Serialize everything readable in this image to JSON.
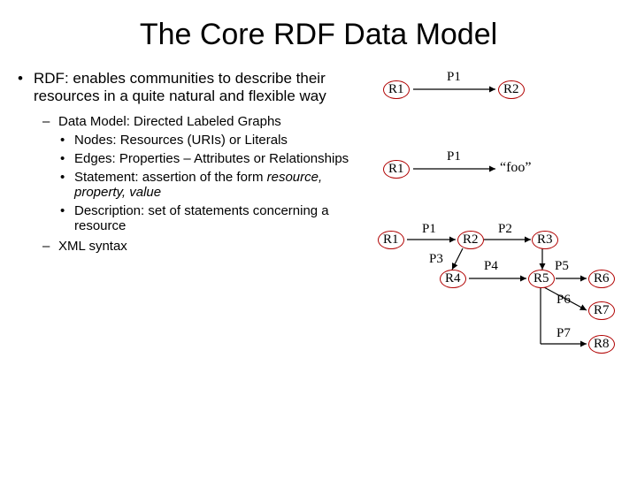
{
  "title": "The Core RDF Data Model",
  "main_bullet": "RDF: enables communities to describe their resources in a quite natural and flexible way",
  "sub1": "Data Model: Directed Labeled Graphs",
  "nodes": "Nodes: Resources (URIs) or Literals",
  "edges": "Edges: Properties – Attributes or Relationships",
  "stmt_prefix": "Statement: assertion of the form ",
  "stmt_italic": "resource, property, value",
  "desc": "Description: set of  statements concerning a resource",
  "xml": "XML syntax",
  "d1": {
    "r1": "R1",
    "p1": "P1",
    "r2": "R2"
  },
  "d2": {
    "r1": "R1",
    "p1": "P1",
    "foo": "“foo”"
  },
  "d3": {
    "r1": "R1",
    "r2": "R2",
    "r3": "R3",
    "r4": "R4",
    "r5": "R5",
    "r6": "R6",
    "r7": "R7",
    "r8": "R8",
    "p1": "P1",
    "p2": "P2",
    "p3": "P3",
    "p4": "P4",
    "p5": "P5",
    "p6": "P6",
    "p7": "P7"
  }
}
